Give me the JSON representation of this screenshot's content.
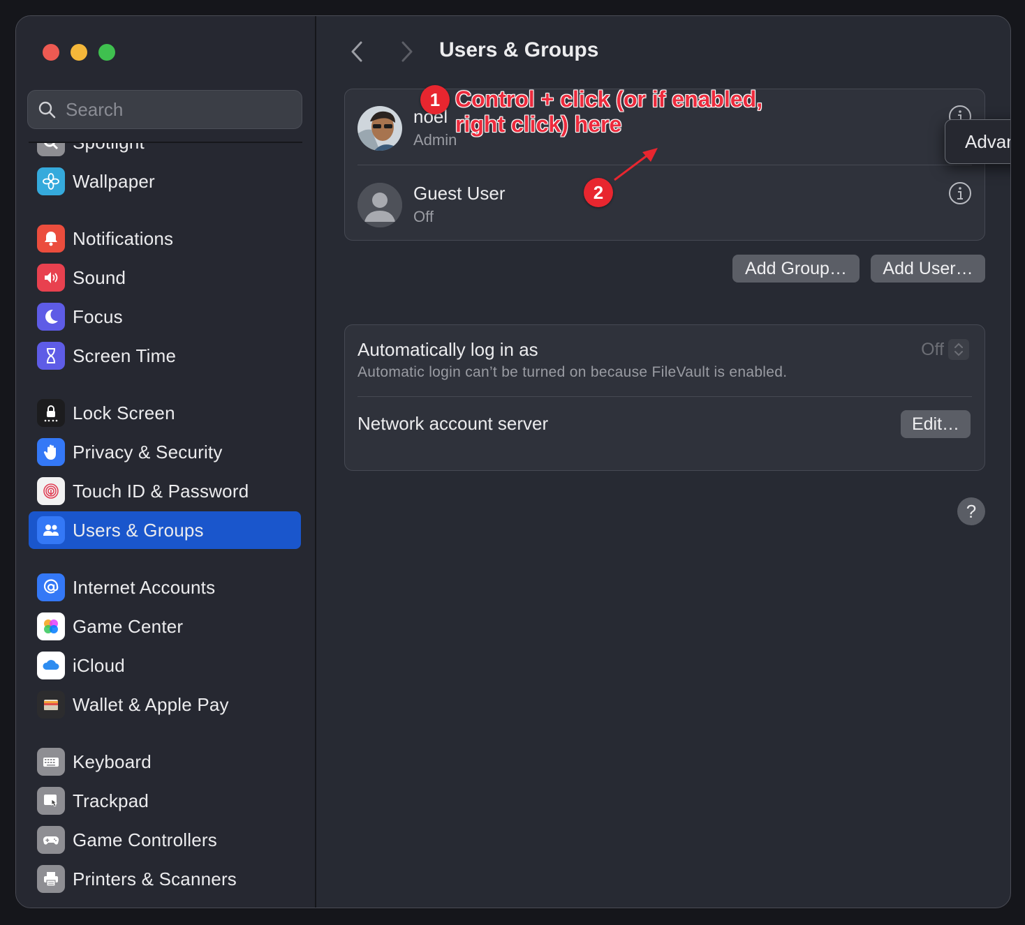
{
  "window": {
    "title": "Users & Groups"
  },
  "sidebar": {
    "search_placeholder": "Search",
    "items": [
      {
        "label": "Spotlight",
        "icon": "magnifier-icon",
        "color": "#8e8e93"
      },
      {
        "label": "Wallpaper",
        "icon": "flower-icon",
        "color": "#35aadc"
      },
      {
        "label": "Notifications",
        "icon": "bell-icon",
        "color": "#eb4d3d"
      },
      {
        "label": "Sound",
        "icon": "speaker-icon",
        "color": "#e8414f"
      },
      {
        "label": "Focus",
        "icon": "moon-icon",
        "color": "#5e5ce6"
      },
      {
        "label": "Screen Time",
        "icon": "hourglass-icon",
        "color": "#5e5ce6"
      },
      {
        "label": "Lock Screen",
        "icon": "lock-icon",
        "color": "#1c1c1e"
      },
      {
        "label": "Privacy & Security",
        "icon": "hand-icon",
        "color": "#3478f6"
      },
      {
        "label": "Touch ID & Password",
        "icon": "fingerprint-icon",
        "color": "#f2f2f2"
      },
      {
        "label": "Users & Groups",
        "icon": "users-icon",
        "color": "#3478f6",
        "selected": true
      },
      {
        "label": "Internet Accounts",
        "icon": "at-icon",
        "color": "#3478f6"
      },
      {
        "label": "Game Center",
        "icon": "game-center-icon",
        "color": "#ffffff"
      },
      {
        "label": "iCloud",
        "icon": "cloud-icon",
        "color": "#ffffff"
      },
      {
        "label": "Wallet & Apple Pay",
        "icon": "wallet-icon",
        "color": "#2c2c2e"
      },
      {
        "label": "Keyboard",
        "icon": "keyboard-icon",
        "color": "#8e8e93"
      },
      {
        "label": "Trackpad",
        "icon": "trackpad-icon",
        "color": "#8e8e93"
      },
      {
        "label": "Game Controllers",
        "icon": "gamepad-icon",
        "color": "#8e8e93"
      },
      {
        "label": "Printers & Scanners",
        "icon": "printer-icon",
        "color": "#8e8e93"
      }
    ]
  },
  "main": {
    "users": [
      {
        "name": "noel",
        "role": "Admin"
      },
      {
        "name": "Guest User",
        "role": "Off"
      }
    ],
    "buttons": {
      "add_group": "Add Group…",
      "add_user": "Add User…",
      "edit": "Edit…",
      "help": "?"
    },
    "auto_login": {
      "title": "Automatically log in as",
      "subtitle": "Automatic login can’t be turned on because FileVault is enabled.",
      "value": "Off"
    },
    "network_server": {
      "label": "Network account server"
    }
  },
  "context_menu": {
    "item": "Advanced Options…"
  },
  "annotations": {
    "step1_badge": "1",
    "step1_line1": "Control + click (or if enabled,",
    "step1_line2": "right click) here",
    "step2_badge": "2",
    "color": "#e8262f"
  }
}
